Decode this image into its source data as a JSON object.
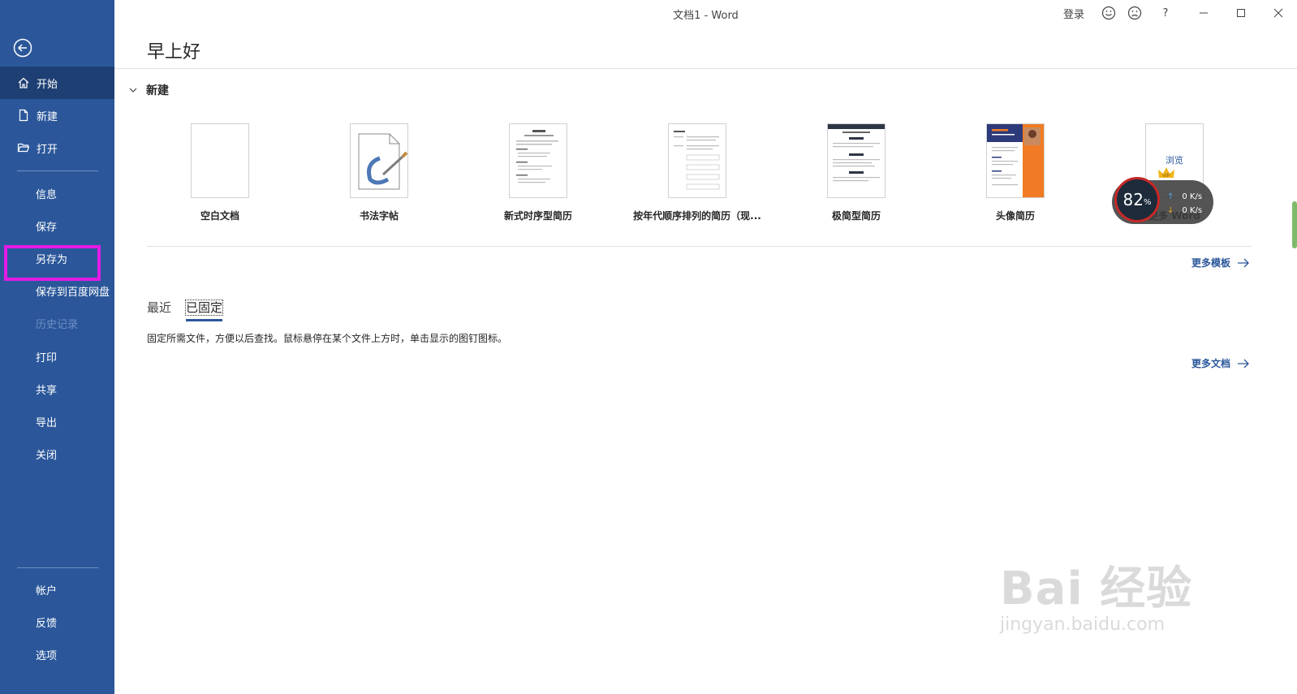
{
  "window": {
    "title": "文档1  -  Word",
    "login": "登录",
    "help": "?"
  },
  "sidebar": {
    "items": [
      {
        "label": "开始"
      },
      {
        "label": "新建"
      },
      {
        "label": "打开"
      },
      {
        "label": "信息"
      },
      {
        "label": "保存"
      },
      {
        "label": "另存为"
      },
      {
        "label": "保存到百度网盘"
      },
      {
        "label": "历史记录"
      },
      {
        "label": "打印"
      },
      {
        "label": "共享"
      },
      {
        "label": "导出"
      },
      {
        "label": "关闭"
      },
      {
        "label": "帐户"
      },
      {
        "label": "反馈"
      },
      {
        "label": "选项"
      }
    ]
  },
  "main": {
    "greeting": "早上好",
    "new_section": "新建",
    "templates": [
      {
        "name": "空白文档"
      },
      {
        "name": "书法字帖"
      },
      {
        "name": "新式时序型简历"
      },
      {
        "name": "按年代顺序排列的简历（现..."
      },
      {
        "name": "极简型简历"
      },
      {
        "name": "头像简历"
      },
      {
        "name": "更多 Word",
        "thumb_text": "浏览"
      }
    ],
    "more_templates": "更多模板",
    "tabs": [
      {
        "label": "最近"
      },
      {
        "label": "已固定"
      }
    ],
    "pinned_hint": "固定所需文件，方便以后查找。鼠标悬停在某个文件上方时，单击显示的图钉图标。",
    "more_docs": "更多文档"
  },
  "speed_widget": {
    "percent": "82",
    "percent_sign": "%",
    "upload": "0 K/s",
    "download": "0 K/s"
  },
  "watermark": {
    "main": "Bai 经验",
    "url": "jingyan.baidu.com"
  },
  "colors": {
    "sidebar": "#2b579a",
    "sidebar_active": "#1e3f73",
    "highlight": "#e31be6",
    "link": "#2b579a"
  }
}
